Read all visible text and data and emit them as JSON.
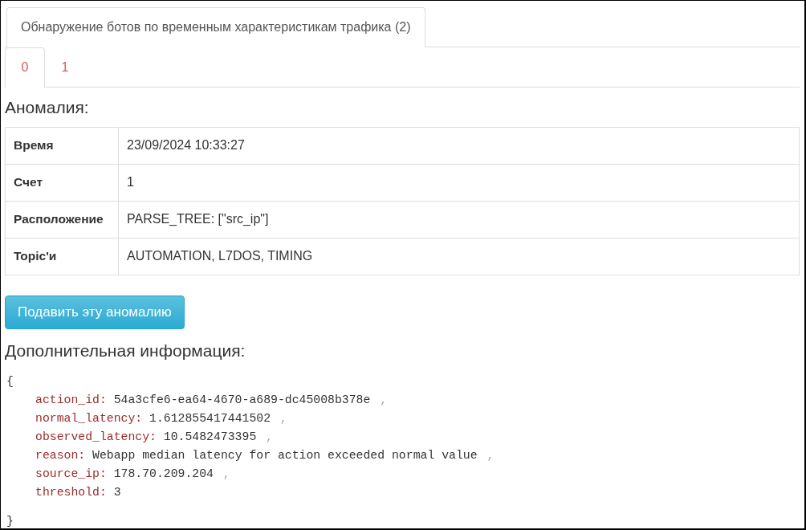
{
  "outer_tabs": [
    {
      "label": "Обнаружение ботов по временным характеристикам трафика (2)",
      "selected": true
    }
  ],
  "inner_tabs": [
    {
      "label": "0",
      "selected": true
    },
    {
      "label": "1",
      "selected": false
    }
  ],
  "anomaly": {
    "heading": "Аномалия:",
    "rows": [
      {
        "label": "Время",
        "value": "23/09/2024 10:33:27"
      },
      {
        "label": "Счет",
        "value": "1"
      },
      {
        "label": "Расположение",
        "value": "PARSE_TREE: [\"src_ip\"]"
      },
      {
        "label": "Topic'и",
        "value": "AUTOMATION, L7DOS, TIMING"
      }
    ]
  },
  "suppress_button": "Подавить эту аномалию",
  "details": {
    "heading": "Дополнительная информация:",
    "open_brace": "{",
    "entries": [
      {
        "key": "action_id:",
        "value": "54a3cfe6-ea64-4670-a689-dc45008b378e",
        "separator": ","
      },
      {
        "key": "normal_latency:",
        "value": "1.612855417441502",
        "separator": ","
      },
      {
        "key": "observed_latency:",
        "value": "10.5482473395",
        "separator": ","
      },
      {
        "key": "reason:",
        "value": "Webapp median latency for action exceeded normal value",
        "separator": ","
      },
      {
        "key": "source_ip:",
        "value": "178.70.209.204",
        "separator": ","
      },
      {
        "key": "threshold:",
        "value": "3"
      }
    ],
    "close_brace": "}"
  }
}
